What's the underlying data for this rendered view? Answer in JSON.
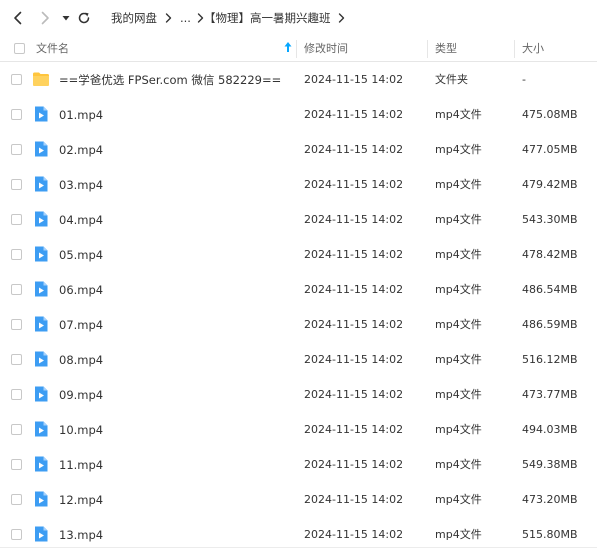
{
  "breadcrumb": {
    "root": "我的网盘",
    "ellipsis": "...",
    "current": "【物理】高一暑期兴趣班"
  },
  "columns": {
    "name": "文件名",
    "modified": "修改时间",
    "type": "类型",
    "size": "大小"
  },
  "files": [
    {
      "name": "==学爸优选 FPSer.com 微信 582229==",
      "modified": "2024-11-15 14:02",
      "type": "文件夹",
      "size": "-",
      "icon": "folder-icon"
    },
    {
      "name": "01.mp4",
      "modified": "2024-11-15 14:02",
      "type": "mp4文件",
      "size": "475.08MB",
      "icon": "video-file-icon"
    },
    {
      "name": "02.mp4",
      "modified": "2024-11-15 14:02",
      "type": "mp4文件",
      "size": "477.05MB",
      "icon": "video-file-icon"
    },
    {
      "name": "03.mp4",
      "modified": "2024-11-15 14:02",
      "type": "mp4文件",
      "size": "479.42MB",
      "icon": "video-file-icon"
    },
    {
      "name": "04.mp4",
      "modified": "2024-11-15 14:02",
      "type": "mp4文件",
      "size": "543.30MB",
      "icon": "video-file-icon"
    },
    {
      "name": "05.mp4",
      "modified": "2024-11-15 14:02",
      "type": "mp4文件",
      "size": "478.42MB",
      "icon": "video-file-icon"
    },
    {
      "name": "06.mp4",
      "modified": "2024-11-15 14:02",
      "type": "mp4文件",
      "size": "486.54MB",
      "icon": "video-file-icon"
    },
    {
      "name": "07.mp4",
      "modified": "2024-11-15 14:02",
      "type": "mp4文件",
      "size": "486.59MB",
      "icon": "video-file-icon"
    },
    {
      "name": "08.mp4",
      "modified": "2024-11-15 14:02",
      "type": "mp4文件",
      "size": "516.12MB",
      "icon": "video-file-icon"
    },
    {
      "name": "09.mp4",
      "modified": "2024-11-15 14:02",
      "type": "mp4文件",
      "size": "473.77MB",
      "icon": "video-file-icon"
    },
    {
      "name": "10.mp4",
      "modified": "2024-11-15 14:02",
      "type": "mp4文件",
      "size": "494.03MB",
      "icon": "video-file-icon"
    },
    {
      "name": "11.mp4",
      "modified": "2024-11-15 14:02",
      "type": "mp4文件",
      "size": "549.38MB",
      "icon": "video-file-icon"
    },
    {
      "name": "12.mp4",
      "modified": "2024-11-15 14:02",
      "type": "mp4文件",
      "size": "473.20MB",
      "icon": "video-file-icon"
    },
    {
      "name": "13.mp4",
      "modified": "2024-11-15 14:02",
      "type": "mp4文件",
      "size": "515.80MB",
      "icon": "video-file-icon"
    }
  ],
  "colors": {
    "accent": "#06a7ff",
    "folder": "#ffc53d",
    "video": "#3d9df3"
  }
}
